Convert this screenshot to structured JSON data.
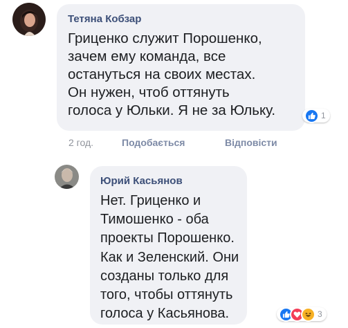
{
  "comments": [
    {
      "author": "Тетяна Кобзар",
      "text": "Гриценко служит Порошенко,\nзачем ему команда, все\nостануться на своих местах.\nОн нужен, чтоб оттянуть\nголоса у Юльки. Я не за Юльку.",
      "reactions": {
        "icons": [
          "like-icon"
        ],
        "count": "1"
      },
      "meta": {
        "time": "2 год.",
        "like_label": "Подобається",
        "reply_label": "Відповісти"
      }
    },
    {
      "author": "Юрий Касьянов",
      "text": "Нет. Гриценко и\nТимошенко - оба\nпроекты Порошенко.\nКак и Зеленский. Они\nсозданы только для\nтого, чтобы оттянуть\nголоса у Касьянова.",
      "reactions": {
        "icons": [
          "like-icon",
          "love-icon",
          "haha-icon"
        ],
        "count": "3"
      }
    }
  ],
  "colors": {
    "bubble": "#f0f1f5",
    "author": "#3c4f78",
    "like": "#1877f2",
    "love": "#f33e58",
    "haha": "#f7b125"
  }
}
